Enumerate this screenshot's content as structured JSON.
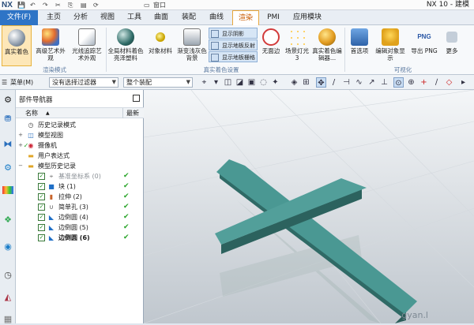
{
  "titlebar": {
    "logo": "NX",
    "window_menu": "窗口",
    "title": "NX 10 - 建模"
  },
  "menubar": {
    "items": [
      "文件(F)",
      "主页",
      "分析",
      "视图",
      "工具",
      "曲面",
      "装配",
      "曲线",
      "渲染",
      "PMI",
      "应用模块"
    ]
  },
  "ribbon": {
    "buttons": [
      {
        "label": "真实着色",
        "name": "true-shading",
        "selected": true
      },
      {
        "label": "高级艺术外观",
        "name": "advanced-studio"
      },
      {
        "label": "光线追踪艺术外观",
        "name": "ray-traced-studio"
      },
      {
        "label": "全局材料着色亮泽塑料",
        "name": "global-material"
      },
      {
        "label": "对象材料",
        "name": "object-material"
      },
      {
        "label": "渐变浅灰色背景",
        "name": "gradient-background"
      },
      {
        "label": "无面边",
        "name": "no-face-edges"
      },
      {
        "label": "场景灯光 3",
        "name": "scene-lights"
      },
      {
        "label": "真实着色编辑器...",
        "name": "shading-editor"
      },
      {
        "label": "首选项",
        "name": "preferences"
      },
      {
        "label": "编辑对象显示",
        "name": "edit-object-display"
      },
      {
        "label": "导出 PNG",
        "name": "export-png"
      },
      {
        "label": "更多",
        "name": "more"
      }
    ],
    "small": [
      {
        "label": "显示阴影",
        "on": true
      },
      {
        "label": "显示地板反射",
        "on": true
      },
      {
        "label": "显示地板栅格",
        "on": true
      }
    ],
    "groups": [
      "渲染模式",
      "真实着色设置",
      "可视化"
    ]
  },
  "toolbar": {
    "menu_label": "菜单(M)",
    "filter_value": "没有选择过滤器",
    "scope_value": "整个装配"
  },
  "navigator": {
    "title": "部件导航器",
    "col_name": "名称",
    "col_latest": "最新",
    "rows": [
      {
        "label": "历史记录模式",
        "level": 0,
        "icon": "clock",
        "exp": ""
      },
      {
        "label": "模型视图",
        "level": 0,
        "icon": "views",
        "exp": "+"
      },
      {
        "label": "摄像机",
        "level": 0,
        "icon": "camera",
        "exp": "+"
      },
      {
        "label": "用户表达式",
        "level": 0,
        "icon": "folder",
        "exp": ""
      },
      {
        "label": "模型历史记录",
        "level": 0,
        "icon": "folder",
        "exp": "−"
      },
      {
        "label": "基准坐标系 (0)",
        "level": 1,
        "icon": "datum",
        "latest": true,
        "grey": true
      },
      {
        "label": "块 (1)",
        "level": 1,
        "icon": "block",
        "latest": true
      },
      {
        "label": "拉伸 (2)",
        "level": 1,
        "icon": "extrude",
        "latest": true
      },
      {
        "label": "简单孔 (3)",
        "level": 1,
        "icon": "hole",
        "latest": true
      },
      {
        "label": "边倒圆 (4)",
        "level": 1,
        "icon": "blend",
        "latest": true
      },
      {
        "label": "边倒圆 (5)",
        "level": 1,
        "icon": "blend",
        "latest": true
      },
      {
        "label": "边倒圆 (6)",
        "level": 1,
        "icon": "blend",
        "latest": true,
        "bold": true
      }
    ]
  },
  "viewport": {
    "watermark": "gyan.l",
    "model_color": "#4a9893"
  }
}
